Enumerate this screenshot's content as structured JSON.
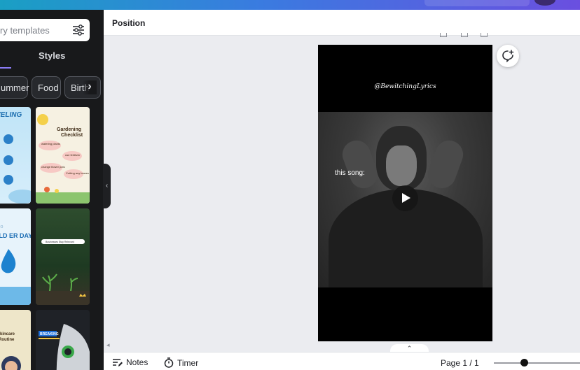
{
  "sidebar": {
    "search_placeholder": "ry templates",
    "tab_styles": "Styles",
    "chips": [
      "ummer",
      "Food",
      "Birth"
    ],
    "templates": [
      {
        "title": "VELING"
      },
      {
        "title": "Gardening Checklist",
        "items": [
          "watering plants",
          "use fertilizer",
          "change flower pots",
          "Cutting any leaves"
        ]
      },
      {
        "title": "RLD ER DAY",
        "subtitle": "A O"
      },
      {
        "title": "",
        "bar_text": "Businesses Stay Relevant"
      },
      {
        "title": "Skincare Routine"
      },
      {
        "title": "",
        "badge": "BREAKING"
      }
    ]
  },
  "header": {
    "title": "Position"
  },
  "canvas": {
    "watermark": "@BewitchingLyrics",
    "video_caption": "this song:"
  },
  "footer": {
    "notes_label": "Notes",
    "timer_label": "Timer",
    "page_indicator": "Page 1 / 1"
  },
  "icons": {
    "filter": "sliders-icon",
    "comment": "comment-add-icon",
    "play": "play-icon",
    "notes": "notes-icon",
    "timer": "timer-icon"
  },
  "colors": {
    "topbar_start": "#1a9fc4",
    "topbar_end": "#6a4fe0",
    "sidebar_bg": "#18191b",
    "tab_accent": "#8b7cf6",
    "canvas_bg": "#ebecf0"
  }
}
